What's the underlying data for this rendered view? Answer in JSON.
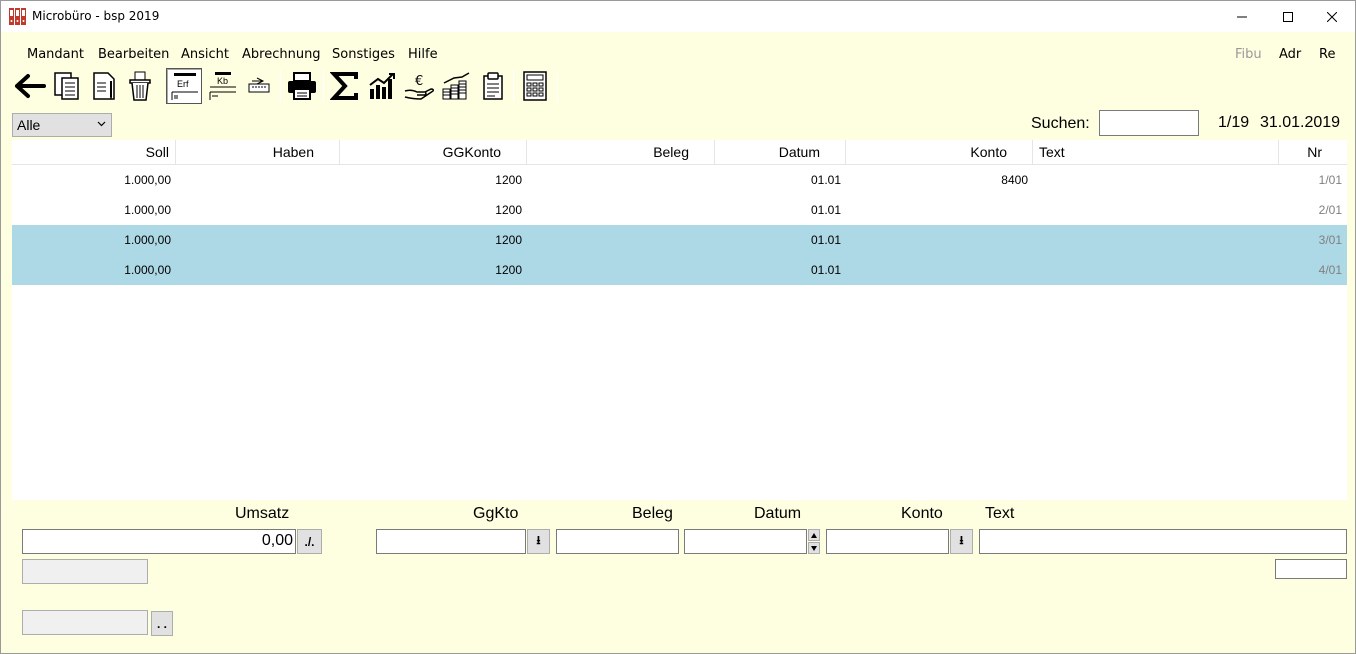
{
  "window": {
    "title": "Microbüro  -  bsp 2019",
    "controls": [
      "minimize-icon",
      "maximize-icon",
      "close-icon"
    ]
  },
  "menu": {
    "items": [
      "Mandant",
      "Bearbeiten",
      "Ansicht",
      "Abrechnung",
      "Sonstiges",
      "Hilfe"
    ],
    "right_links": [
      "Fibu",
      "Adr",
      "Re"
    ]
  },
  "toolbar": {
    "buttons": [
      {
        "icon": "back-arrow-icon"
      },
      {
        "icon": "copy-documents-icon"
      },
      {
        "icon": "edit-document-icon"
      },
      {
        "icon": "delete-trash-icon"
      },
      {
        "icon": "erf-entry-icon",
        "label": "Erf",
        "pressed": true
      },
      {
        "icon": "kb-cashbook-icon",
        "label": "Kb"
      },
      {
        "icon": "bank-transfer-icon"
      },
      {
        "icon": "printer-icon"
      },
      {
        "icon": "sum-sigma-icon"
      },
      {
        "icon": "bar-chart-icon"
      },
      {
        "icon": "euro-hand-icon"
      },
      {
        "icon": "coin-stacks-icon"
      },
      {
        "icon": "clipboard-list-icon"
      },
      {
        "icon": "calculator-icon"
      }
    ]
  },
  "filter": {
    "selected": "Alle"
  },
  "search": {
    "label": "Suchen:",
    "value": ""
  },
  "status": {
    "page": "1/19",
    "date": "31.01.2019"
  },
  "table": {
    "columns": [
      "Soll",
      "Haben",
      "GGKonto",
      "Beleg",
      "Datum",
      "Konto",
      "Text",
      "Nr"
    ],
    "rows": [
      {
        "soll": "1.000,00",
        "haben": "",
        "ggkonto": "1200",
        "beleg": "",
        "datum": "01.01",
        "konto": "8400",
        "text": "",
        "nr": "1/01",
        "selected": false
      },
      {
        "soll": "1.000,00",
        "haben": "",
        "ggkonto": "1200",
        "beleg": "",
        "datum": "01.01",
        "konto": "",
        "text": "",
        "nr": "2/01",
        "selected": false
      },
      {
        "soll": "1.000,00",
        "haben": "",
        "ggkonto": "1200",
        "beleg": "",
        "datum": "01.01",
        "konto": "",
        "text": "",
        "nr": "3/01",
        "selected": true
      },
      {
        "soll": "1.000,00",
        "haben": "",
        "ggkonto": "1200",
        "beleg": "",
        "datum": "01.01",
        "konto": "",
        "text": "",
        "nr": "4/01",
        "selected": true
      }
    ],
    "selection_color": "#add8e6"
  },
  "form": {
    "labels": {
      "umsatz": "Umsatz",
      "ggkto": "GgKto",
      "beleg": "Beleg",
      "datum": "Datum",
      "konto": "Konto",
      "text": "Text"
    },
    "umsatz_value": "0,00",
    "sign_button": "./.",
    "lookup_button": "⭳",
    "more_button": ". ."
  }
}
